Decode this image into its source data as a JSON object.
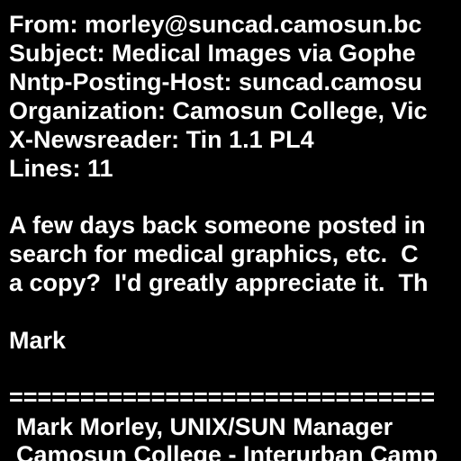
{
  "colors": {
    "background": "#000000",
    "text": "#ffffff"
  },
  "header": {
    "from": "From: morley@suncad.camosun.bc",
    "subject": "Subject: Medical Images via Gophe",
    "nntp_host": "Nntp-Posting-Host: suncad.camosu",
    "organization": "Organization: Camosun College, Vic",
    "newsreader": "X-Newsreader: Tin 1.1 PL4",
    "lines": "Lines: 11"
  },
  "body": {
    "line1": "A few days back someone posted in",
    "line2": "search for medical graphics, etc.  C",
    "line3": "a copy?  I'd greatly appreciate it.  Th",
    "signoff": "Mark"
  },
  "signature": {
    "rule": "==============================",
    "name": "Mark Morley, UNIX/SUN Manager",
    "college": "Camosun College - Interurban Camp"
  }
}
